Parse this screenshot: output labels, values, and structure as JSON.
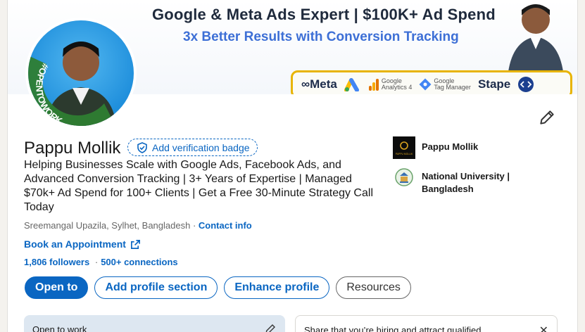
{
  "banner": {
    "title": "Google & Meta Ads Expert | $100K+ Ad Spend",
    "subtitle": "3x Better Results with Conversion Tracking",
    "logos": {
      "meta": "∞Meta",
      "analytics_top": "Google",
      "analytics_bottom": "Analytics 4",
      "tagmanager_top": "Google",
      "tagmanager_bottom": "Tag Manager",
      "stape": "Stape"
    },
    "avatar_badge": "#OPENTOWORK"
  },
  "profile": {
    "name": "Pappu Mollik",
    "verify_label": "Add verification badge",
    "headline": "Helping Businesses Scale with Google Ads, Facebook Ads, and Advanced Conversion Tracking | 3+ Years of Expertise | Managed $70k+ Ad Spend for 100+ Clients | Get a Free 30-Minute Strategy Call Today",
    "location": "Sreemangal Upazila, Sylhet, Bangladesh",
    "location_sep": "·",
    "contact_label": "Contact info",
    "appointment_label": "Book an Appointment",
    "followers": "1,806 followers",
    "connections": "500+ connections",
    "stats_sep": "·"
  },
  "actions": {
    "open_to": "Open to",
    "add_section": "Add profile section",
    "enhance": "Enhance profile",
    "resources": "Resources"
  },
  "side": {
    "company": "Pappu Mollik",
    "company_logo_text": "PAPPU MOLLIK",
    "education": "National University | Bangladesh"
  },
  "bottom": {
    "open_to_work": "Open to work",
    "hiring": "Share that you’re hiring and attract qualified"
  },
  "colors": {
    "accent": "#0a66c2",
    "badge_green": "#2e7d32"
  }
}
